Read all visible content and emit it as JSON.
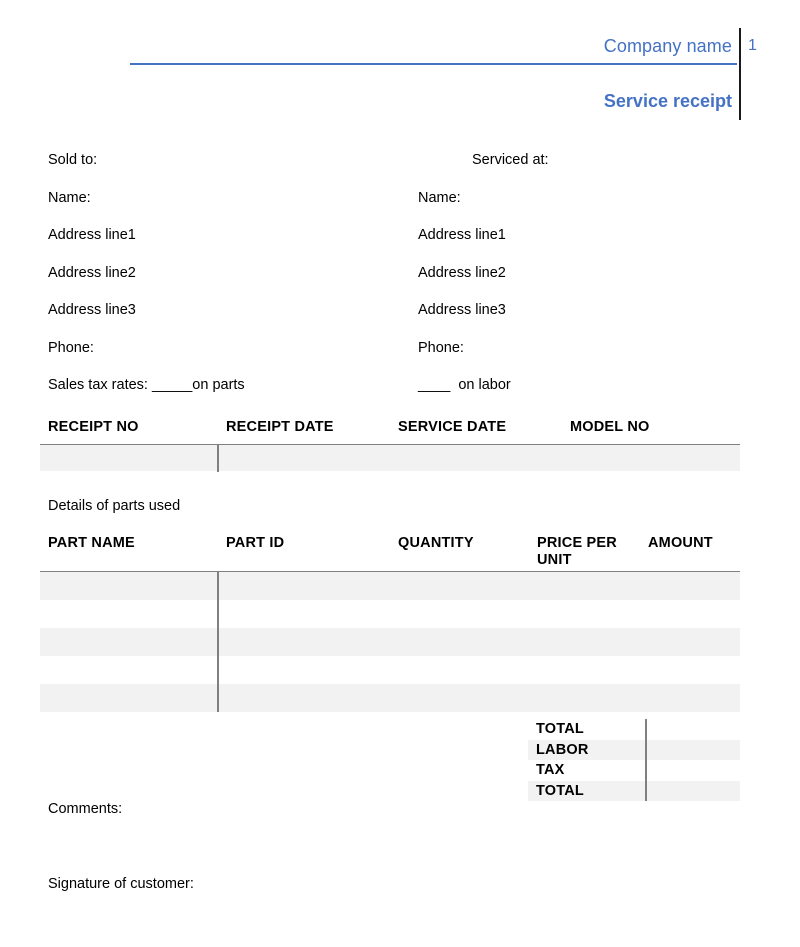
{
  "header": {
    "company_name": "Company name",
    "page_number": "1",
    "document_title": "Service receipt",
    "accent_color": "#4472c4",
    "rule_color": "#4472c4",
    "divider_color": "#1a1a1a"
  },
  "parties": {
    "sold_to": {
      "heading": "Sold to:",
      "name_label": "Name:",
      "address_line1": "Address line1",
      "address_line2": "Address line2",
      "address_line3": "Address line3",
      "phone_label": "Phone:",
      "tax_rate_line": "Sales tax rates: _____on parts"
    },
    "serviced_at": {
      "heading": "Serviced at:",
      "name_label": "Name:",
      "address_line1": "Address line1",
      "address_line2": "Address line2",
      "address_line3": "Address line3",
      "phone_label": "Phone:",
      "tax_rate_line": "____  on labor"
    }
  },
  "receipt_table": {
    "columns": [
      "RECEIPT NO",
      "RECEIPT DATE",
      "SERVICE DATE",
      "MODEL NO"
    ],
    "rows": [
      {
        "receipt_no": "",
        "receipt_date": "",
        "service_date": "",
        "model_no": ""
      }
    ]
  },
  "parts_section": {
    "label": "Details of parts used",
    "columns": [
      "PART NAME",
      "PART ID",
      "QUANTITY",
      "PRICE PER\nUNIT",
      "AMOUNT"
    ],
    "rows": [
      {
        "part_name": "",
        "part_id": "",
        "quantity": "",
        "price_per_unit": "",
        "amount": ""
      },
      {
        "part_name": "",
        "part_id": "",
        "quantity": "",
        "price_per_unit": "",
        "amount": ""
      },
      {
        "part_name": "",
        "part_id": "",
        "quantity": "",
        "price_per_unit": "",
        "amount": ""
      },
      {
        "part_name": "",
        "part_id": "",
        "quantity": "",
        "price_per_unit": "",
        "amount": ""
      },
      {
        "part_name": "",
        "part_id": "",
        "quantity": "",
        "price_per_unit": "",
        "amount": ""
      }
    ]
  },
  "totals": {
    "rows": [
      {
        "label": "TOTAL",
        "value": ""
      },
      {
        "label": "LABOR",
        "value": ""
      },
      {
        "label": "TAX",
        "value": ""
      },
      {
        "label": "TOTAL",
        "value": ""
      }
    ]
  },
  "footer": {
    "comments_label": "Comments:",
    "signature_label": "Signature of customer:"
  },
  "style": {
    "row_shade_color": "#f2f2f2",
    "table_rule_color": "#7f7f7f"
  }
}
